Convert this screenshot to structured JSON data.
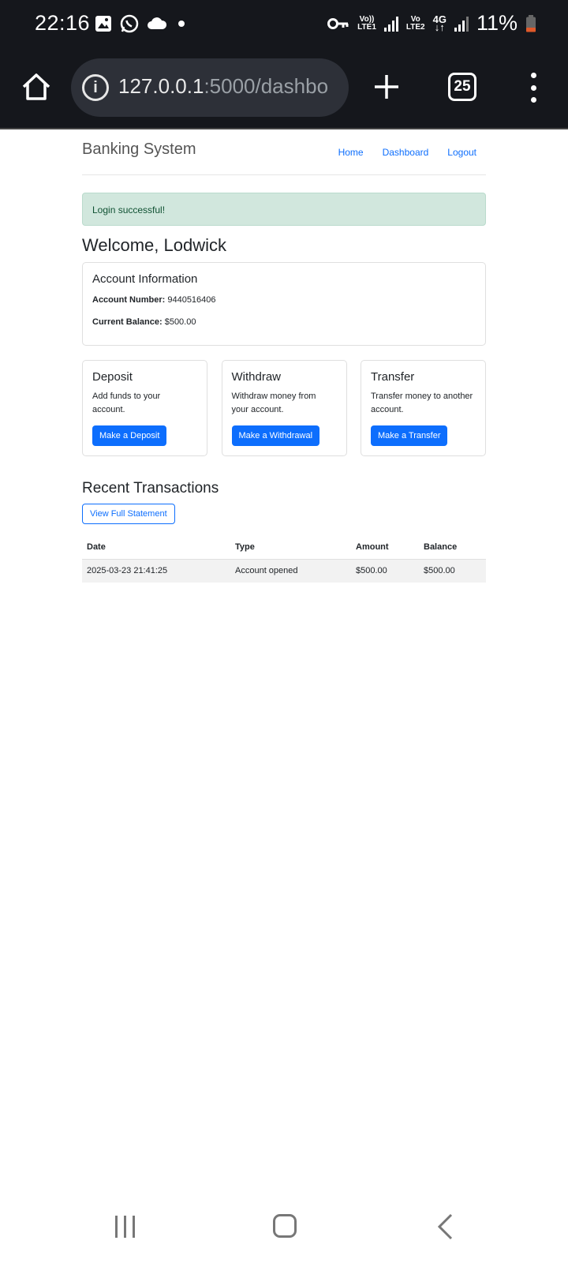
{
  "status_bar": {
    "time": "22:16",
    "left_icons": [
      "gallery-icon",
      "whatsapp-icon",
      "cloud-icon",
      "dot-icon"
    ],
    "sim1_label_top": "Vo))",
    "sim1_label_bottom": "LTE1",
    "sim2_label_top": "Vo",
    "sim2_label_bottom": "LTE2",
    "network_label": "4G",
    "battery_percent": "11%"
  },
  "browser": {
    "url_host": "127.0.0.1",
    "url_rest": ":5000/dashbo",
    "tab_count": "25"
  },
  "navbar": {
    "brand": "Banking System",
    "links": [
      "Home",
      "Dashboard",
      "Logout"
    ]
  },
  "alert": {
    "message": "Login successful!"
  },
  "welcome": "Welcome, Lodwick",
  "account": {
    "title": "Account Information",
    "number_label": "Account Number:",
    "number_value": "9440516406",
    "balance_label": "Current Balance:",
    "balance_value": "$500.00"
  },
  "actions": [
    {
      "title": "Deposit",
      "desc": "Add funds to your account.",
      "button": "Make a Deposit"
    },
    {
      "title": "Withdraw",
      "desc": "Withdraw money from your account.",
      "button": "Make a Withdrawal"
    },
    {
      "title": "Transfer",
      "desc": "Transfer money to another account.",
      "button": "Make a Transfer"
    }
  ],
  "transactions": {
    "title": "Recent Transactions",
    "statement_button": "View Full Statement",
    "headers": [
      "Date",
      "Type",
      "Amount",
      "Balance"
    ],
    "rows": [
      [
        "2025-03-23 21:41:25",
        "Account opened",
        "$500.00",
        "$500.00"
      ]
    ]
  },
  "colors": {
    "primary": "#0d6efd",
    "alert_bg": "#d1e7dd",
    "alert_text": "#0f5132",
    "chrome_bg": "#15171c"
  }
}
